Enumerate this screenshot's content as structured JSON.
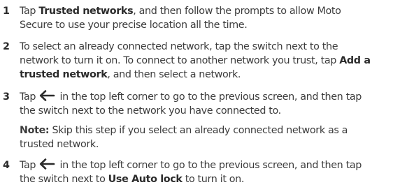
{
  "steps": [
    {
      "number": "1",
      "parts": {
        "a": "Tap ",
        "b": "Trusted networks",
        "c": ", and then follow the prompts to allow Moto",
        "d": "Secure to use your precise location all the time."
      }
    },
    {
      "number": "2",
      "parts": {
        "a": "To select an already connected network, tap the switch next to the",
        "b": "network to turn it on. To connect to another network you trust, tap ",
        "c": "Add a",
        "d": "trusted network",
        "e": ", and then select a network."
      }
    },
    {
      "number": "3",
      "parts": {
        "a": "Tap ",
        "icon": "back-arrow-icon",
        "b": " in the top left corner to go to the previous screen, and then tap",
        "c": "the switch next to the network you have connected to."
      },
      "note": {
        "label": "Note:",
        "a": " Skip this step if you select an already connected network as a",
        "b": "trusted network."
      }
    },
    {
      "number": "4",
      "parts": {
        "a": "Tap ",
        "icon": "back-arrow-icon",
        "b": " in the top left corner to go to the previous screen, and then tap",
        "c": "the switch next to ",
        "d": "Use Auto lock",
        "e": " to turn it on."
      }
    }
  ]
}
